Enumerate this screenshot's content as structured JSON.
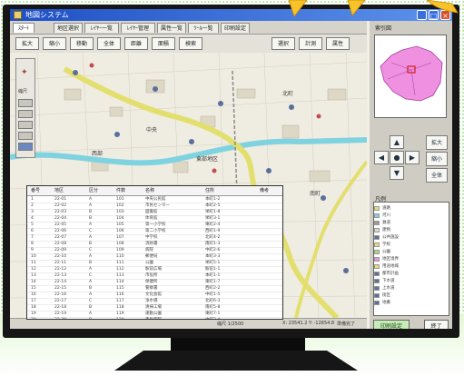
{
  "window": {
    "title": "地図システム",
    "controls": {
      "minimize": "_",
      "maximize": "□",
      "close": "×"
    }
  },
  "tabs": [
    "ｽﾀｰﾄ",
    "地区選択",
    "ﾚｲﾔｰ一覧",
    "ﾚｲﾔｰ管理",
    "属性一覧",
    "ﾂｰﾙ一覧",
    "印刷設定"
  ],
  "toolbar": [
    "拡大",
    "縮小",
    "移動",
    "全体",
    "距離",
    "面積",
    "検索",
    "選択",
    "計測",
    "属性"
  ],
  "map": {
    "labels": [
      "東部地区",
      "西部",
      "中央",
      "北町",
      "南町"
    ],
    "nav_label": "縮尺"
  },
  "table": {
    "headers": [
      "番号",
      "地区",
      "区分",
      "件数",
      "名称",
      "住所",
      "備考"
    ],
    "rows": [
      [
        "1",
        "22-01",
        "A",
        "101",
        "中央公民館",
        "本町1-2",
        ""
      ],
      [
        "2",
        "22-02",
        "A",
        "102",
        "市民センター",
        "本町2-5",
        ""
      ],
      [
        "3",
        "22-03",
        "B",
        "103",
        "図書館",
        "栄町1-8",
        ""
      ],
      [
        "4",
        "22-04",
        "B",
        "104",
        "体育館",
        "栄町3-1",
        ""
      ],
      [
        "5",
        "22-05",
        "A",
        "105",
        "第一小学校",
        "東町2-4",
        ""
      ],
      [
        "6",
        "22-06",
        "C",
        "106",
        "第二小学校",
        "西町1-9",
        ""
      ],
      [
        "7",
        "22-07",
        "A",
        "107",
        "中学校",
        "北町4-2",
        ""
      ],
      [
        "8",
        "22-08",
        "B",
        "108",
        "消防署",
        "南町1-3",
        ""
      ],
      [
        "9",
        "22-09",
        "C",
        "109",
        "病院",
        "中町2-6",
        ""
      ],
      [
        "10",
        "22-10",
        "A",
        "110",
        "郵便局",
        "本町3-3",
        ""
      ],
      [
        "11",
        "22-11",
        "B",
        "111",
        "公園",
        "栄町5-1",
        ""
      ],
      [
        "12",
        "22-12",
        "A",
        "112",
        "駅前広場",
        "駅前1-1",
        ""
      ],
      [
        "13",
        "22-13",
        "C",
        "113",
        "市役所",
        "本町1-1",
        ""
      ],
      [
        "14",
        "22-14",
        "A",
        "114",
        "保健所",
        "東町1-7",
        ""
      ],
      [
        "15",
        "22-15",
        "B",
        "115",
        "警察署",
        "西町2-2",
        ""
      ],
      [
        "16",
        "22-16",
        "A",
        "116",
        "文化会館",
        "中町1-5",
        ""
      ],
      [
        "17",
        "22-17",
        "C",
        "117",
        "浄水場",
        "北町6-3",
        ""
      ],
      [
        "18",
        "22-18",
        "B",
        "118",
        "清掃工場",
        "南町5-8",
        ""
      ],
      [
        "19",
        "22-19",
        "A",
        "119",
        "運動公園",
        "東町7-1",
        ""
      ],
      [
        "20",
        "22-20",
        "B",
        "120",
        "市民病院",
        "中町3-4",
        ""
      ]
    ]
  },
  "side": {
    "overview_label": "索引図",
    "pad": {
      "up": "▲",
      "down": "▼",
      "left": "◀",
      "right": "▶",
      "center": "●"
    },
    "zoom_in": "拡大",
    "zoom_out": "縮小",
    "all": "全体",
    "legend_title": "凡例",
    "legend": [
      "道路",
      "河川",
      "鉄道",
      "建物",
      "公共施設",
      "学校",
      "公園",
      "地区境界",
      "用途地域",
      "都市計画",
      "下水道",
      "上水道",
      "街区",
      "地番"
    ],
    "btn_print": "印刷設定",
    "btn_end": "終了"
  },
  "status": {
    "left": "縮尺 1/2500",
    "mid": "X: 23541.2 Y: -12654.8",
    "right": "準備完了"
  },
  "colors": {
    "title_bar": "#1e4fc4",
    "road": "#e3df6e",
    "river": "#7fd2e0",
    "pointer": "#f7c22a",
    "region": "#f090e0"
  }
}
